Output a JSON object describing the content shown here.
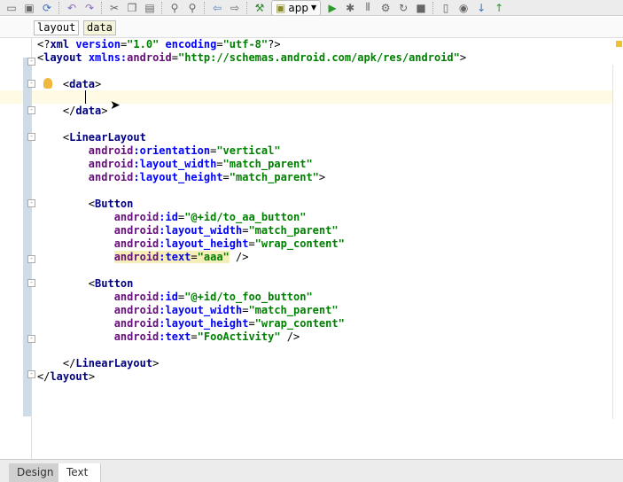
{
  "toolbar": {
    "run_config": "app",
    "icons": [
      "open-icon",
      "save-icon",
      "sync-icon",
      "undo-icon",
      "redo-icon",
      "cut-icon",
      "copy-icon",
      "paste-icon",
      "find-icon",
      "replace-icon",
      "back-icon",
      "forward-icon",
      "build-icon",
      "run-icon",
      "debug-icon",
      "profile-icon",
      "attach-icon",
      "rerun-icon",
      "stop-icon",
      "avd-icon",
      "sdk-icon",
      "vcs-update-icon",
      "vcs-commit-icon"
    ]
  },
  "breadcrumbs": [
    "layout",
    "data"
  ],
  "code": [
    [
      {
        "c": "pun",
        "t": "<?"
      },
      {
        "c": "tag",
        "t": "xml "
      },
      {
        "c": "attr",
        "t": "version"
      },
      {
        "c": "pun",
        "t": "="
      },
      {
        "c": "val",
        "t": "\"1.0\" "
      },
      {
        "c": "attr",
        "t": "encoding"
      },
      {
        "c": "pun",
        "t": "="
      },
      {
        "c": "val",
        "t": "\"utf-8\""
      },
      {
        "c": "pun",
        "t": "?>"
      }
    ],
    [
      {
        "c": "pun",
        "t": "<"
      },
      {
        "c": "tag",
        "t": "layout "
      },
      {
        "c": "attr",
        "t": "xmlns:"
      },
      {
        "c": "pfx",
        "t": "android"
      },
      {
        "c": "pun",
        "t": "="
      },
      {
        "c": "val",
        "t": "\"http://schemas.android.com/apk/res/android\""
      },
      {
        "c": "pun",
        "t": ">"
      }
    ],
    [],
    [
      {
        "c": "pun",
        "t": "    <"
      },
      {
        "c": "tag",
        "t": "data"
      },
      {
        "c": "pun",
        "t": ">"
      }
    ],
    [
      {
        "c": "pun",
        "t": "        "
      }
    ],
    [
      {
        "c": "pun",
        "t": "    </"
      },
      {
        "c": "tag",
        "t": "data"
      },
      {
        "c": "pun",
        "t": ">"
      }
    ],
    [],
    [
      {
        "c": "pun",
        "t": "    <"
      },
      {
        "c": "tag",
        "t": "LinearLayout"
      }
    ],
    [
      {
        "c": "pfx",
        "t": "        android"
      },
      {
        "c": "attr",
        "t": ":orientation"
      },
      {
        "c": "pun",
        "t": "="
      },
      {
        "c": "val",
        "t": "\"vertical\""
      }
    ],
    [
      {
        "c": "pfx",
        "t": "        android"
      },
      {
        "c": "attr",
        "t": ":layout_width"
      },
      {
        "c": "pun",
        "t": "="
      },
      {
        "c": "val",
        "t": "\"match_parent\""
      }
    ],
    [
      {
        "c": "pfx",
        "t": "        android"
      },
      {
        "c": "attr",
        "t": ":layout_height"
      },
      {
        "c": "pun",
        "t": "="
      },
      {
        "c": "val",
        "t": "\"match_parent\""
      },
      {
        "c": "pun",
        "t": ">"
      }
    ],
    [],
    [
      {
        "c": "pun",
        "t": "        <"
      },
      {
        "c": "tag",
        "t": "Button"
      }
    ],
    [
      {
        "c": "pfx",
        "t": "            android"
      },
      {
        "c": "attr",
        "t": ":id"
      },
      {
        "c": "pun",
        "t": "="
      },
      {
        "c": "val",
        "t": "\"@+id/to_aa_button\""
      }
    ],
    [
      {
        "c": "pfx",
        "t": "            android"
      },
      {
        "c": "attr",
        "t": ":layout_width"
      },
      {
        "c": "pun",
        "t": "="
      },
      {
        "c": "val",
        "t": "\"match_parent\""
      }
    ],
    [
      {
        "c": "pfx",
        "t": "            android"
      },
      {
        "c": "attr",
        "t": ":layout_height"
      },
      {
        "c": "pun",
        "t": "="
      },
      {
        "c": "val",
        "t": "\"wrap_content\""
      }
    ],
    [
      {
        "c": "pun",
        "t": "            "
      },
      {
        "c": "pfx hl",
        "t": "android"
      },
      {
        "c": "attr hl",
        "t": ":text"
      },
      {
        "c": "pun hl",
        "t": "="
      },
      {
        "c": "val hl",
        "t": "\"aaa\""
      },
      {
        "c": "pun",
        "t": " />"
      }
    ],
    [],
    [
      {
        "c": "pun",
        "t": "        <"
      },
      {
        "c": "tag",
        "t": "Button"
      }
    ],
    [
      {
        "c": "pfx",
        "t": "            android"
      },
      {
        "c": "attr",
        "t": ":id"
      },
      {
        "c": "pun",
        "t": "="
      },
      {
        "c": "val",
        "t": "\"@+id/to_foo_button\""
      }
    ],
    [
      {
        "c": "pfx",
        "t": "            android"
      },
      {
        "c": "attr",
        "t": ":layout_width"
      },
      {
        "c": "pun",
        "t": "="
      },
      {
        "c": "val",
        "t": "\"match_parent\""
      }
    ],
    [
      {
        "c": "pfx",
        "t": "            android"
      },
      {
        "c": "attr",
        "t": ":layout_height"
      },
      {
        "c": "pun",
        "t": "="
      },
      {
        "c": "val",
        "t": "\"wrap_content\""
      }
    ],
    [
      {
        "c": "pfx",
        "t": "            android"
      },
      {
        "c": "attr",
        "t": ":text"
      },
      {
        "c": "pun",
        "t": "="
      },
      {
        "c": "val",
        "t": "\"FooActivity\""
      },
      {
        "c": "pun",
        "t": " />"
      }
    ],
    [],
    [
      {
        "c": "pun",
        "t": "    </"
      },
      {
        "c": "tag",
        "t": "LinearLayout"
      },
      {
        "c": "pun",
        "t": ">"
      }
    ],
    [
      {
        "c": "pun",
        "t": "</"
      },
      {
        "c": "tag",
        "t": "layout"
      },
      {
        "c": "pun",
        "t": ">"
      }
    ]
  ],
  "bottom_tabs": [
    "Design",
    "Text"
  ]
}
